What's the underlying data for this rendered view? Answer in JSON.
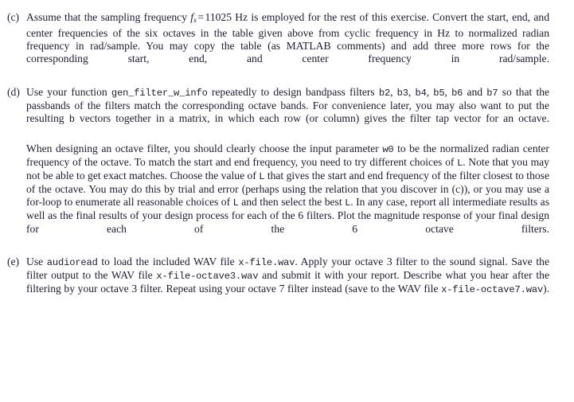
{
  "document": {
    "type": "exercise-list",
    "text_color": "#1c1c33",
    "background_color": "#ffffff",
    "items": [
      {
        "label": "(c)",
        "name": "item-c",
        "paragraphs": [
          {
            "name": "item-c-paragraph-1",
            "runs": [
              {
                "type": "text",
                "text": "Assume that the sampling frequency "
              },
              {
                "type": "math",
                "text": "f_s = 11025",
                "var": "f",
                "sub": "s",
                "op": "=",
                "num": "11025"
              },
              {
                "type": "text",
                "text": " Hz is employed for the rest of this exercise. Convert the start, end, and center frequencies of the six octaves in the table given above from cyclic frequency in Hz to normalized radian frequency in rad/sample. You may copy the table (as MATLAB comments) and add three more rows for the corresponding start, end, and center frequency in rad/sample."
              }
            ],
            "plain": "Assume that the sampling frequency f_s = 11025 Hz is employed for the rest of this exercise. Convert the start, end, and center frequencies of the six octaves in the table given above from cyclic frequency in Hz to normalized radian frequency in rad/sample. You may copy the table (as MATLAB comments) and add three more rows for the corresponding start, end, and center frequency in rad/sample."
          }
        ]
      },
      {
        "label": "(d)",
        "name": "item-d",
        "paragraphs": [
          {
            "name": "item-d-paragraph-1",
            "plain": "Use your function gen_filter_w_info repeatedly to design bandpass filters b2, b3, b4, b5, b6 and b7 so that the passbands of the filters match the corresponding octave bands. For convenience later, you may also want to put the resulting b vectors together in a matrix, in which each row (or column) gives the filter tap vector for an octave."
          },
          {
            "name": "item-d-paragraph-2",
            "plain": "When designing an octave filter, you should clearly choose the input parameter w0 to be the normalized radian center frequency of the octave. To match the start and end frequency, you need to try different choices of L. Note that you may not be able to get exact matches. Choose the value of L that gives the start and end frequency of the filter closest to those of the octave. You may do this by trial and error (perhaps using the relation that you discover in (c)), or you may use a for-loop to enumerate all reasonable choices of L and then select the best L. In any case, report all intermediate results as well as the final results of your design process for each of the 6 filters. Plot the magnitude response of your final design for each of the 6 octave filters."
          }
        ]
      },
      {
        "label": "(e)",
        "name": "item-e",
        "paragraphs": [
          {
            "name": "item-e-paragraph-1",
            "plain": "Use audioread to load the included WAV file x-file.wav. Apply your octave 3 filter to the sound signal. Save the filter output to the WAV file x-file-octave3.wav and submit it with your report. Describe what you hear after the filtering by your octave 3 filter. Repeat using your octave 7 filter instead (save to the WAV file x-file-octave7.wav)."
          }
        ]
      }
    ]
  },
  "content": {
    "item_c": {
      "label": "(c)",
      "seg1": "Assume that the sampling frequency",
      "math_f": "f",
      "math_sub": "s",
      "math_eq": "=",
      "math_val": "11025",
      "seg2": "Hz is employed for the rest of this exercise. Convert the start, end, and center frequencies of the six octaves in the table given above from cyclic frequency in Hz to normalized radian frequency in rad/sample. You may copy the table (as MATLAB comments) and add three more rows for the corresponding start, end, and center frequency in rad/sample."
    },
    "item_d": {
      "label": "(d)",
      "p1_seg1": "Use your function",
      "p1_code1": "gen_filter_w_info",
      "p1_seg2": "repeatedly to design bandpass filters",
      "p1_code2": "b2",
      "p1_comma2": ",",
      "p1_code3": "b3",
      "p1_comma3": ",",
      "p1_code4": "b4",
      "p1_comma4": ",",
      "p1_code5": "b5",
      "p1_comma5": ",",
      "p1_code6": "b6",
      "p1_seg3": "and",
      "p1_code7": "b7",
      "p1_seg4": "so that the passbands of the filters match the corresponding octave bands. For convenience later, you may also want to put the resulting",
      "p1_code8": "b",
      "p1_seg5": "vectors together in a matrix, in which each row (or column) gives the filter tap vector for an octave.",
      "p2_seg1": "When designing an octave filter, you should clearly choose the input parameter",
      "p2_code1": "w0",
      "p2_seg2": "to be the normalized radian center frequency of the octave. To match the start and end frequency, you need to try different choices of",
      "p2_code2": "L",
      "p2_seg3": ". Note that you may not be able to get exact matches. Choose the value of",
      "p2_code3": "L",
      "p2_seg4": "that gives the start and end frequency of the filter closest to those of the octave. You may do this by trial and error (perhaps using the relation that you discover in (c)), or you may use a for-loop to enumerate all reasonable choices of",
      "p2_code4": "L",
      "p2_seg5": "and then select the best",
      "p2_code5": "L",
      "p2_seg6": ". In any case, report all intermediate results as well as the final results of your design process for each of the 6 filters. Plot the magnitude response of your final design for each of the 6 octave filters."
    },
    "item_e": {
      "label": "(e)",
      "seg1": "Use",
      "code1": "audioread",
      "seg2": "to load the included WAV file",
      "code2": "x-file.wav",
      "seg3": ". Apply your octave 3 filter to the sound signal. Save the filter output to the WAV file",
      "code3": "x-file-octave3.wav",
      "seg4": "and submit it with your report. Describe what you hear after the filtering by your octave 3 filter. Repeat using your octave 7 filter instead (save to the WAV file",
      "code4": "x-file-octave7.wav",
      "seg5": ")."
    }
  }
}
